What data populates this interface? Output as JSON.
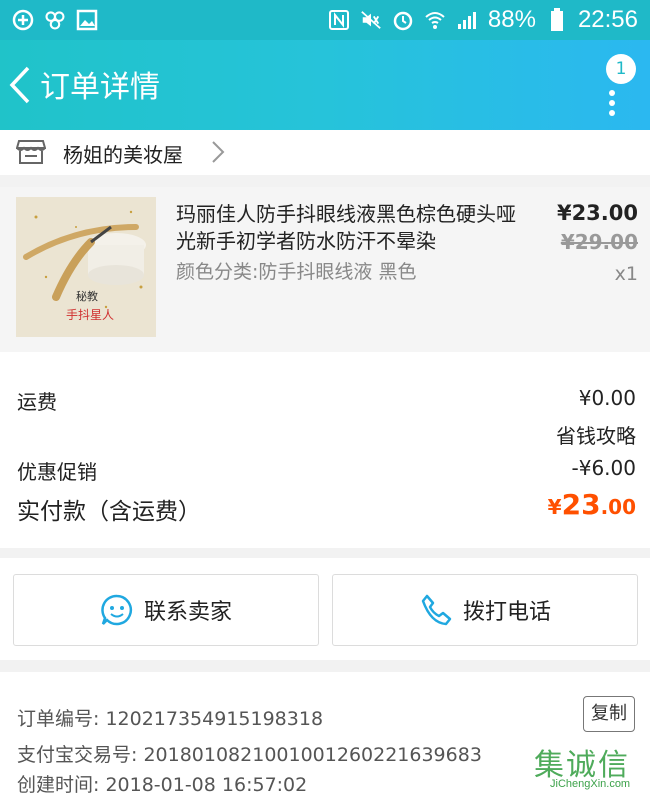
{
  "status_bar": {
    "battery": "88%",
    "time": "22:56"
  },
  "nav": {
    "title": "订单详情",
    "badge_count": "1"
  },
  "shop": {
    "name": "杨姐的美妆屋"
  },
  "product": {
    "title": "玛丽佳人防手抖眼线液黑色棕色硬头哑光新手初学者防水防汗不晕染",
    "spec": "颜色分类:防手抖眼线液 黑色",
    "price": "¥23.00",
    "original_price": "¥29.00",
    "quantity": "x1",
    "image_text_line1": "秘教",
    "image_text_line2": "手抖星人"
  },
  "fees": {
    "shipping_label": "运费",
    "shipping_value": "¥0.00",
    "tips_link": "省钱攻略",
    "promo_label": "优惠促销",
    "promo_value": "-¥6.00",
    "paid_label": "实付款（含运费）",
    "paid_symbol": "¥",
    "paid_int": "23",
    "paid_dec": ".00"
  },
  "actions": {
    "contact_seller": "联系卖家",
    "call_phone": "拨打电话"
  },
  "order_info": {
    "order_no": "订单编号: 120217354915198318",
    "alipay_no": "支付宝交易号: 2018010821001001260221639683",
    "created_at": "创建时间: 2018-01-08 16:57:02",
    "copy_label": "复制"
  },
  "watermark": {
    "cn": "集诚信",
    "en": "JiChengXin.com"
  },
  "colors": {
    "nav_gradient_start": "#20c3c9",
    "nav_gradient_end": "#2bb8f0",
    "price_accent": "#ff5000"
  }
}
